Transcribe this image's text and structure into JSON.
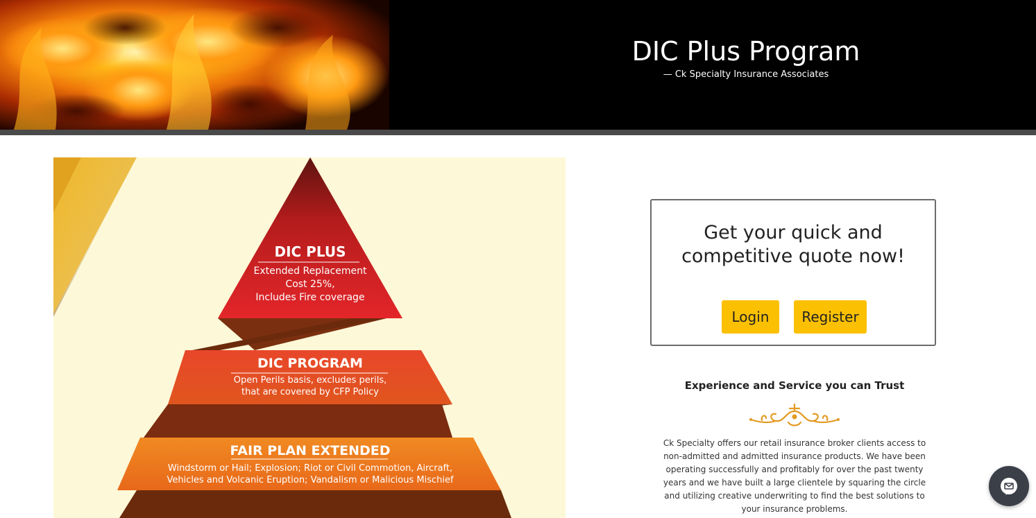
{
  "header": {
    "title": "DIC Plus Program",
    "subtitle": "—  Ck Specialty Insurance Associates"
  },
  "graphic": {
    "tiers": [
      {
        "title": "DIC PLUS",
        "lines": [
          "Extended Replacement",
          "Cost 25%,",
          "Includes Fire coverage"
        ]
      },
      {
        "title": "DIC PROGRAM",
        "lines": [
          "Open Perils basis, excludes perils,",
          "that are covered by CFP Policy"
        ]
      },
      {
        "title": "FAIR PLAN EXTENDED",
        "lines": [
          "Windstorm or Hail; Explosion; Riot or Civil Commotion, Aircraft,",
          "Vehicles and Volcanic Eruption; Vandalism or Malicious Mischief"
        ]
      }
    ]
  },
  "quote": {
    "heading_line1": "Get your quick and",
    "heading_line2": "competitive quote now!",
    "login_label": "Login",
    "register_label": "Register"
  },
  "trust": {
    "heading": "Experience and Service you can Trust",
    "body": "Ck Specialty offers our retail insurance broker clients access to non-admitted and admitted insurance products. We have been operating successfully and profitably for over the past twenty years and we have built a large clientele by squaring the circle and utilizing creative underwriting to find the best solutions to your insurance problems."
  },
  "icons": {
    "chat": "chat-bubble-icon",
    "ornament": "flourish-ornament-icon"
  },
  "colors": {
    "accent_button": "#fcc003",
    "header_bg": "#000000",
    "chat_bg": "#3a3f48"
  }
}
